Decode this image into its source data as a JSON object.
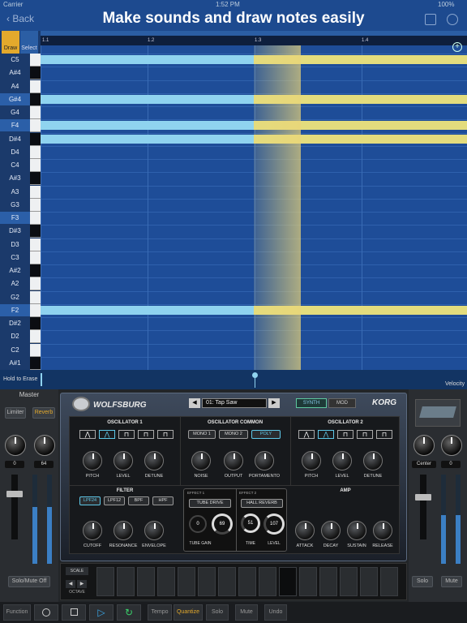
{
  "status_bar": {
    "carrier": "Carrier",
    "time": "1:52 PM",
    "battery": "100%"
  },
  "headline": "Make sounds and draw notes easily",
  "nav": {
    "back_label": "Back"
  },
  "tools": {
    "draw": "Draw",
    "select": "Select"
  },
  "ruler": {
    "marks": [
      "1.1",
      "1.2",
      "1.3",
      "1.4"
    ]
  },
  "piano_keys": [
    "C5",
    "A#4",
    "A4",
    "G#4",
    "G4",
    "F4",
    "D#4",
    "D4",
    "C4",
    "A#3",
    "A3",
    "G3",
    "F3",
    "D#3",
    "D3",
    "C3",
    "A#2",
    "A2",
    "G2",
    "F2",
    "D#2",
    "D2",
    "C2",
    "A#1"
  ],
  "notes": [
    {
      "pitch": "C5",
      "start": 1.0,
      "end": 1.5,
      "state": "selected"
    },
    {
      "pitch": "C5",
      "start": 1.5,
      "end": 2.0,
      "state": "normal"
    },
    {
      "pitch": "G#4",
      "start": 1.0,
      "end": 1.5,
      "state": "selected"
    },
    {
      "pitch": "G#4",
      "start": 1.5,
      "end": 2.0,
      "state": "normal"
    },
    {
      "pitch": "F4",
      "start": 1.0,
      "end": 1.5,
      "state": "selected"
    },
    {
      "pitch": "F4",
      "start": 1.5,
      "end": 2.0,
      "state": "normal"
    },
    {
      "pitch": "D#4",
      "start": 1.0,
      "end": 1.5,
      "state": "selected"
    },
    {
      "pitch": "D#4",
      "start": 1.5,
      "end": 2.0,
      "state": "normal"
    },
    {
      "pitch": "F2",
      "start": 1.0,
      "end": 1.5,
      "state": "selected"
    },
    {
      "pitch": "F2",
      "start": 1.5,
      "end": 2.0,
      "state": "normal"
    }
  ],
  "velocity_bar": {
    "hint": "Hold to Erase",
    "label": "Velocity"
  },
  "colors": {
    "grid": "#1e4d98",
    "note_selected": "#8fd3ef",
    "note_normal": "#e3dc7d",
    "accent_orange": "#e3a92c"
  },
  "left_panel": {
    "title": "Master",
    "limiter": "Limiter",
    "reverb": "Reverb",
    "knob1_value": "0",
    "knob2_value": "64",
    "solo_mute_off": "Solo/Mute Off"
  },
  "right_panel": {
    "pan_label": "Center",
    "knob_value": "0",
    "solo": "Solo",
    "mute": "Mute"
  },
  "synth": {
    "brand": "WOLFSBURG",
    "preset": "01: Tap Saw",
    "tab_synth": "SYNTH",
    "tab_mod": "MOD",
    "maker": "KORG",
    "osc1": {
      "title": "OSCILLATOR 1",
      "knobs": [
        "PITCH",
        "LEVEL",
        "DETUNE"
      ]
    },
    "osc_common": {
      "title": "OSCILLATOR COMMON",
      "modes": [
        "MONO 1",
        "MONO 2",
        "POLY"
      ],
      "knobs": [
        "NOISE",
        "OUTPUT",
        "PORTAMENTO"
      ]
    },
    "osc2": {
      "title": "OSCILLATOR 2",
      "knobs": [
        "PITCH",
        "LEVEL",
        "DETUNE"
      ]
    },
    "filter": {
      "title": "FILTER",
      "types": [
        "LPF24",
        "LPF12",
        "BPF",
        "HPF"
      ],
      "knobs": [
        "CUTOFF",
        "RESONANCE",
        "ENVELOPE"
      ]
    },
    "effect1": {
      "title": "EFFECT 1",
      "name": "TUBE DRIVE",
      "gain_value": "0",
      "drive_value": "69",
      "gain_label": "TUBE GAIN"
    },
    "effect2": {
      "title": "EFFECT 2",
      "name": "HALL REVERB",
      "time_value": "51",
      "level_value": "107",
      "time_label": "TIME",
      "level_label": "LEVEL"
    },
    "amp": {
      "title": "AMP",
      "knobs": [
        "ATTACK",
        "DECAY",
        "SUSTAIN",
        "RELEASE"
      ]
    },
    "keyboard": {
      "scale": "SCALE",
      "octave": "OCTAVE"
    }
  },
  "bottom_bar": [
    "Function",
    "Tempo",
    "Quantize",
    "Solo",
    "Mute",
    "Undo"
  ]
}
